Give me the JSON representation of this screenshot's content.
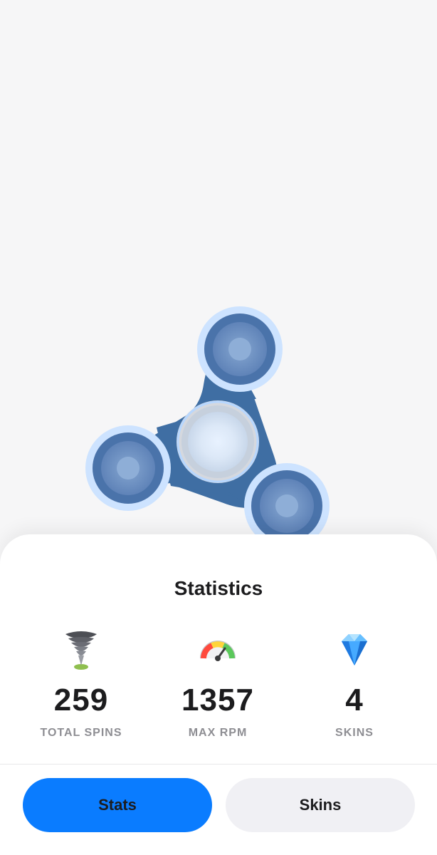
{
  "sheet": {
    "title": "Statistics"
  },
  "stats": [
    {
      "icon": "tornado-icon",
      "value": "259",
      "label": "TOTAL SPINS"
    },
    {
      "icon": "speedometer-icon",
      "value": "1357",
      "label": "MAX RPM"
    },
    {
      "icon": "diamond-icon",
      "value": "4",
      "label": "SKINS"
    }
  ],
  "tabs": {
    "stats_label": "Stats",
    "skins_label": "Skins",
    "active": "Stats"
  },
  "colors": {
    "spinner_body": "#3f6ea3",
    "spinner_cap_outer": "#cde3ff",
    "spinner_cap_inner": "#6b8fc1",
    "accent": "#0a7cff",
    "background": "#f6f6f7"
  }
}
